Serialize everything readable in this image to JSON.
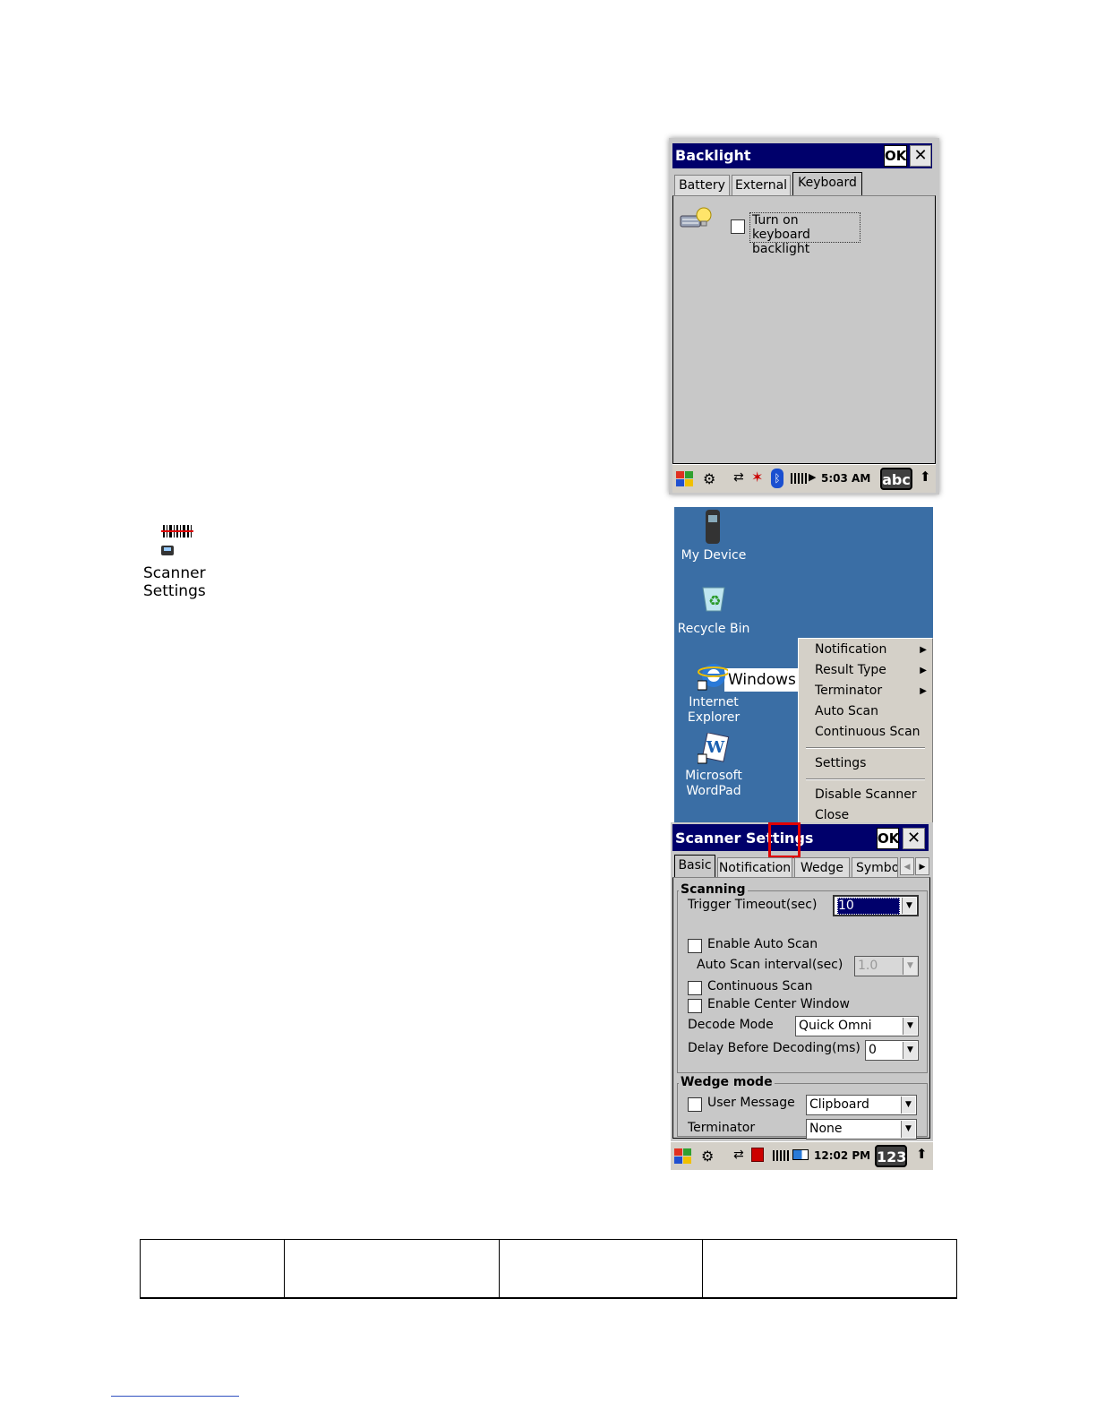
{
  "backlight_window": {
    "title": "Backlight",
    "ok_label": "OK",
    "close_label": "✕",
    "tabs": [
      "Battery",
      "External",
      "Keyboard"
    ],
    "active_tab": "Keyboard",
    "keyboard_backlight": {
      "label_line1": "Turn on keyboard",
      "label_line2": "backlight",
      "checked": false
    },
    "taskbar": {
      "clock": "5:03 AM",
      "input": "abc"
    }
  },
  "scanner_shortcut": {
    "label_line1": "Scanner",
    "label_line2": "Settings"
  },
  "desktop": {
    "icons": [
      {
        "label_line1": "My Device",
        "label_line2": ""
      },
      {
        "label_line1": "Recycle Bin",
        "label_line2": ""
      },
      {
        "label_line1": "Internet",
        "label_line2": "Explorer"
      },
      {
        "label_line1": "Microsoft",
        "label_line2": "WordPad"
      }
    ],
    "banner_text": "Windows E"
  },
  "context_menu": {
    "items": [
      {
        "label": "Notification",
        "submenu": true
      },
      {
        "label": "Result Type",
        "submenu": true
      },
      {
        "label": "Terminator",
        "submenu": true
      },
      {
        "label": "Auto Scan",
        "submenu": false
      },
      {
        "label": "Continuous Scan",
        "submenu": false
      },
      {
        "label": "Settings",
        "submenu": false
      },
      {
        "label": "Disable Scanner",
        "submenu": false
      },
      {
        "label": "Close",
        "submenu": false
      }
    ]
  },
  "scanner_window": {
    "title": "Scanner Settings",
    "ok_label": "OK",
    "close_label": "✕",
    "tabs": [
      "Basic",
      "Notification",
      "Wedge",
      "Symbo"
    ],
    "active_tab": "Basic",
    "scanning": {
      "group_label": "Scanning",
      "trigger_timeout_label": "Trigger Timeout(sec)",
      "trigger_timeout_value": "10",
      "enable_auto_scan_label": "Enable Auto Scan",
      "auto_scan_interval_label": "Auto Scan interval(sec)",
      "auto_scan_interval_value": "1.0",
      "continuous_scan_label": "Continuous Scan",
      "center_window_label": "Enable Center Window",
      "decode_mode_label": "Decode Mode",
      "decode_mode_value": "Quick Omni",
      "delay_label": "Delay Before Decoding(ms)",
      "delay_value": "0"
    },
    "wedge": {
      "group_label": "Wedge mode",
      "user_message_label": "User Message",
      "user_message_value": "Clipboard",
      "terminator_label": "Terminator",
      "terminator_value": "None"
    },
    "taskbar": {
      "clock": "12:02 PM",
      "input": "123"
    }
  },
  "colors": {
    "titlebar": "#00006b",
    "window_bg": "#c8c8c8",
    "desktop": "#3a6ea5",
    "highlight_box": "#e00000"
  }
}
